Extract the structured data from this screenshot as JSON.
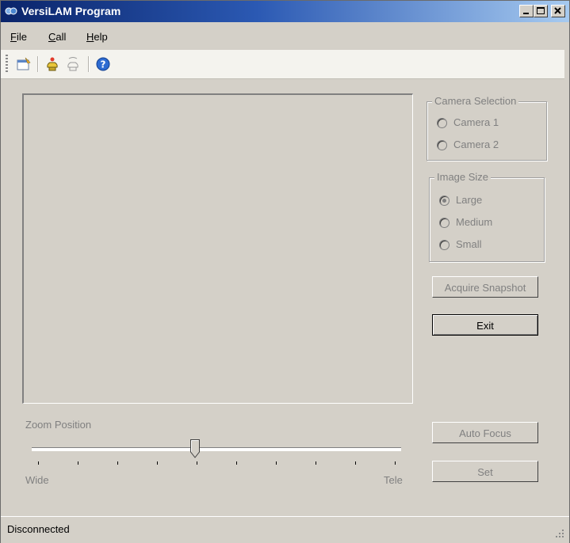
{
  "window": {
    "title": "VersiLAM Program"
  },
  "titlebar": {
    "minimize": "_",
    "maximize": "□",
    "close": "×"
  },
  "menu": {
    "file": "File",
    "call": "Call",
    "help": "Help"
  },
  "toolbar": {
    "icons": [
      "properties-icon",
      "call-icon",
      "hangup-icon",
      "help-icon"
    ]
  },
  "camera_selection": {
    "title": "Camera Selection",
    "options": [
      "Camera 1",
      "Camera 2"
    ]
  },
  "image_size": {
    "title": "Image Size",
    "options": [
      "Large",
      "Medium",
      "Small"
    ],
    "selected": "Large"
  },
  "buttons": {
    "acquire": "Acquire Snapshot",
    "exit": "Exit",
    "auto_focus": "Auto Focus",
    "set": "Set"
  },
  "zoom": {
    "label": "Zoom Position",
    "min_label": "Wide",
    "max_label": "Tele",
    "tick_count": 10,
    "value_fraction": 0.44
  },
  "status": {
    "text": "Disconnected"
  }
}
